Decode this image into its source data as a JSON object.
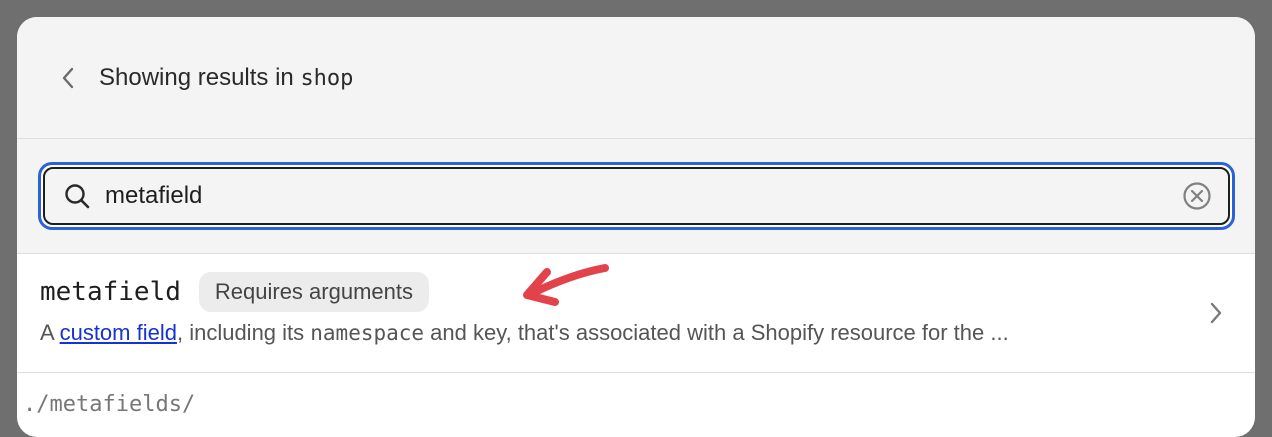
{
  "header": {
    "title_prefix": "Showing results in ",
    "scope": "shop"
  },
  "search": {
    "value": "metafield",
    "placeholder": ""
  },
  "results": [
    {
      "name": "metafield",
      "badge": "Requires arguments",
      "desc_prefix": "A ",
      "desc_link": "custom field",
      "desc_mid": ", including its ",
      "desc_code": "namespace",
      "desc_suffix": " and key, that's associated with a Shopify resource for the ..."
    }
  ],
  "next_row_text": "./metafields/",
  "colors": {
    "accent_focus": "#2a63d8",
    "link": "#1631d9",
    "annotation_arrow": "#e2434b"
  },
  "icons": [
    "chevron-left-icon",
    "search-icon",
    "clear-circle-x-icon",
    "chevron-right-icon",
    "annotation-arrow-icon"
  ]
}
